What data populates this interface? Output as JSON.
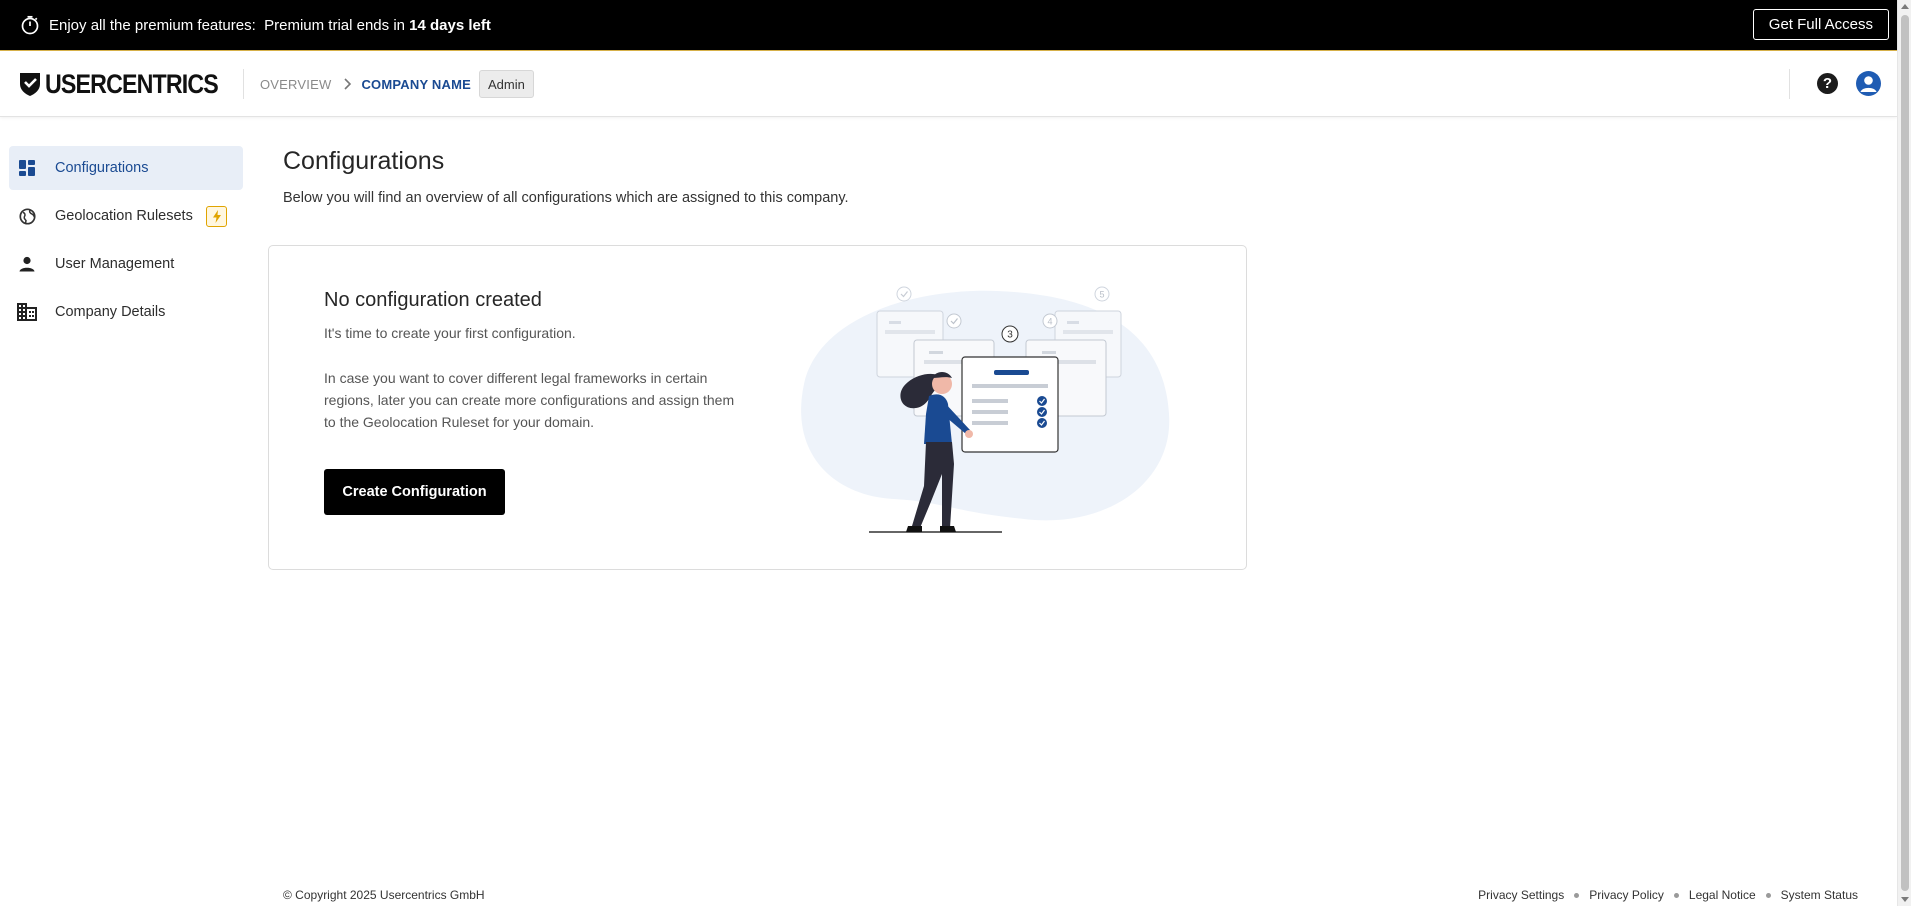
{
  "banner": {
    "message_prefix": "Enjoy all the premium features:",
    "message_middle": "Premium trial ends in",
    "message_bold": "14 days left",
    "cta_label": "Get Full Access"
  },
  "header": {
    "logo_text": "USERCENTRICS",
    "breadcrumb": {
      "overview": "OVERVIEW",
      "company": "COMPANY NAME",
      "role_badge": "Admin"
    },
    "help_glyph": "?"
  },
  "sidebar": {
    "items": [
      {
        "label": "Configurations",
        "icon": "dashboard-icon",
        "active": true
      },
      {
        "label": "Geolocation Rulesets",
        "icon": "globe-icon",
        "active": false,
        "premium_badge": "bolt-icon"
      },
      {
        "label": "User Management",
        "icon": "person-icon",
        "active": false
      },
      {
        "label": "Company Details",
        "icon": "building-icon",
        "active": false
      }
    ]
  },
  "main": {
    "title": "Configurations",
    "subtitle": "Below you will find an overview of all configurations which are assigned to this company.",
    "empty_state": {
      "title": "No configuration created",
      "line1": "It's time to create your first configuration.",
      "paragraph": "In case you want to cover different legal frameworks in certain regions, later you can create more configurations and assign them to the Geolocation Ruleset for your domain.",
      "button_label": "Create Configuration",
      "illustration": {
        "step_numbers": [
          "3",
          "4",
          "5"
        ]
      }
    }
  },
  "footer": {
    "copyright": "© Copyright 2025 Usercentrics GmbH",
    "links": [
      "Privacy Settings",
      "Privacy Policy",
      "Legal Notice",
      "System Status"
    ]
  },
  "colors": {
    "brand_blue": "#1a4a92",
    "active_bg": "#e8eef7",
    "banner_bg": "#000000",
    "premium_yellow": "#e0a400"
  }
}
